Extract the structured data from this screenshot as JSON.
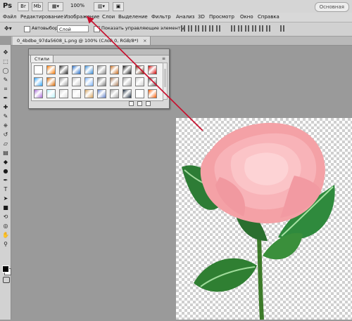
{
  "app": {
    "logo": "Ps",
    "zoom": "100%",
    "workspace_label": "Основная",
    "bridge_label": "Br",
    "minibridge_label": "Mb"
  },
  "menu": [
    {
      "label": "Файл"
    },
    {
      "label": "Редактирование"
    },
    {
      "label": "Изображение"
    },
    {
      "label": "Слои"
    },
    {
      "label": "Выделение"
    },
    {
      "label": "Фильтр"
    },
    {
      "label": "Анализ"
    },
    {
      "label": "3D"
    },
    {
      "label": "Просмотр"
    },
    {
      "label": "Окно"
    },
    {
      "label": "Справка"
    }
  ],
  "options": {
    "autoselect_label": "Автовыбор:",
    "autoselect_value": "Слой",
    "transform_label": "Показать управляющие элементы"
  },
  "document": {
    "tab_title": "0_4bdbe_97da5608_L.png @ 100% (Слой 0, RGB/8*)",
    "close_glyph": "×"
  },
  "styles_panel": {
    "tab_label": "Стили",
    "menu_glyph": "≡",
    "swatches": [
      "#ffffff",
      "#ff7a00",
      "#2b2b2b",
      "#246cc8",
      "#3a8edb",
      "#888888",
      "#c96b1c",
      "#111111",
      "#6a2e11",
      "#d10000",
      "#32a6ff",
      "#dc6a00",
      "#9a9a9a",
      "#c7c7c7",
      "#7eb6ff",
      "#7a7a7a",
      "#aa7a57",
      "#a7a7a7",
      "#cfcfcf",
      "#595959",
      "#a86bd9",
      "#b8f4ff",
      "#d8d8d8",
      "#ececec",
      "#d7a25c",
      "#5f7fc9",
      "#a2a2a2",
      "#1b2a3d",
      "#ffffff",
      "#ff5a00"
    ],
    "footer_icons": [
      "clear-style-icon",
      "new-style-icon",
      "delete-style-icon"
    ]
  },
  "toolbar": {
    "tools": [
      {
        "name": "move-tool-icon",
        "glyph": "✥"
      },
      {
        "name": "marquee-tool-icon",
        "glyph": "⬚"
      },
      {
        "name": "lasso-tool-icon",
        "glyph": "◯"
      },
      {
        "name": "quick-select-tool-icon",
        "glyph": "✎"
      },
      {
        "name": "crop-tool-icon",
        "glyph": "⌗"
      },
      {
        "name": "eyedropper-tool-icon",
        "glyph": "✒"
      },
      {
        "name": "healing-brush-tool-icon",
        "glyph": "✚"
      },
      {
        "name": "brush-tool-icon",
        "glyph": "✎"
      },
      {
        "name": "clone-stamp-tool-icon",
        "glyph": "⎈"
      },
      {
        "name": "history-brush-tool-icon",
        "glyph": "↺"
      },
      {
        "name": "eraser-tool-icon",
        "glyph": "▱"
      },
      {
        "name": "gradient-tool-icon",
        "glyph": "▤"
      },
      {
        "name": "blur-tool-icon",
        "glyph": "◆"
      },
      {
        "name": "dodge-tool-icon",
        "glyph": "●"
      },
      {
        "name": "pen-tool-icon",
        "glyph": "✒"
      },
      {
        "name": "type-tool-icon",
        "glyph": "T"
      },
      {
        "name": "path-selection-tool-icon",
        "glyph": "➤"
      },
      {
        "name": "shape-tool-icon",
        "glyph": "■"
      },
      {
        "name": "3d-rotate-tool-icon",
        "glyph": "⟲"
      },
      {
        "name": "3d-orbit-tool-icon",
        "glyph": "◎"
      },
      {
        "name": "hand-tool-icon",
        "glyph": "✋"
      },
      {
        "name": "zoom-tool-icon",
        "glyph": "⚲"
      }
    ]
  }
}
